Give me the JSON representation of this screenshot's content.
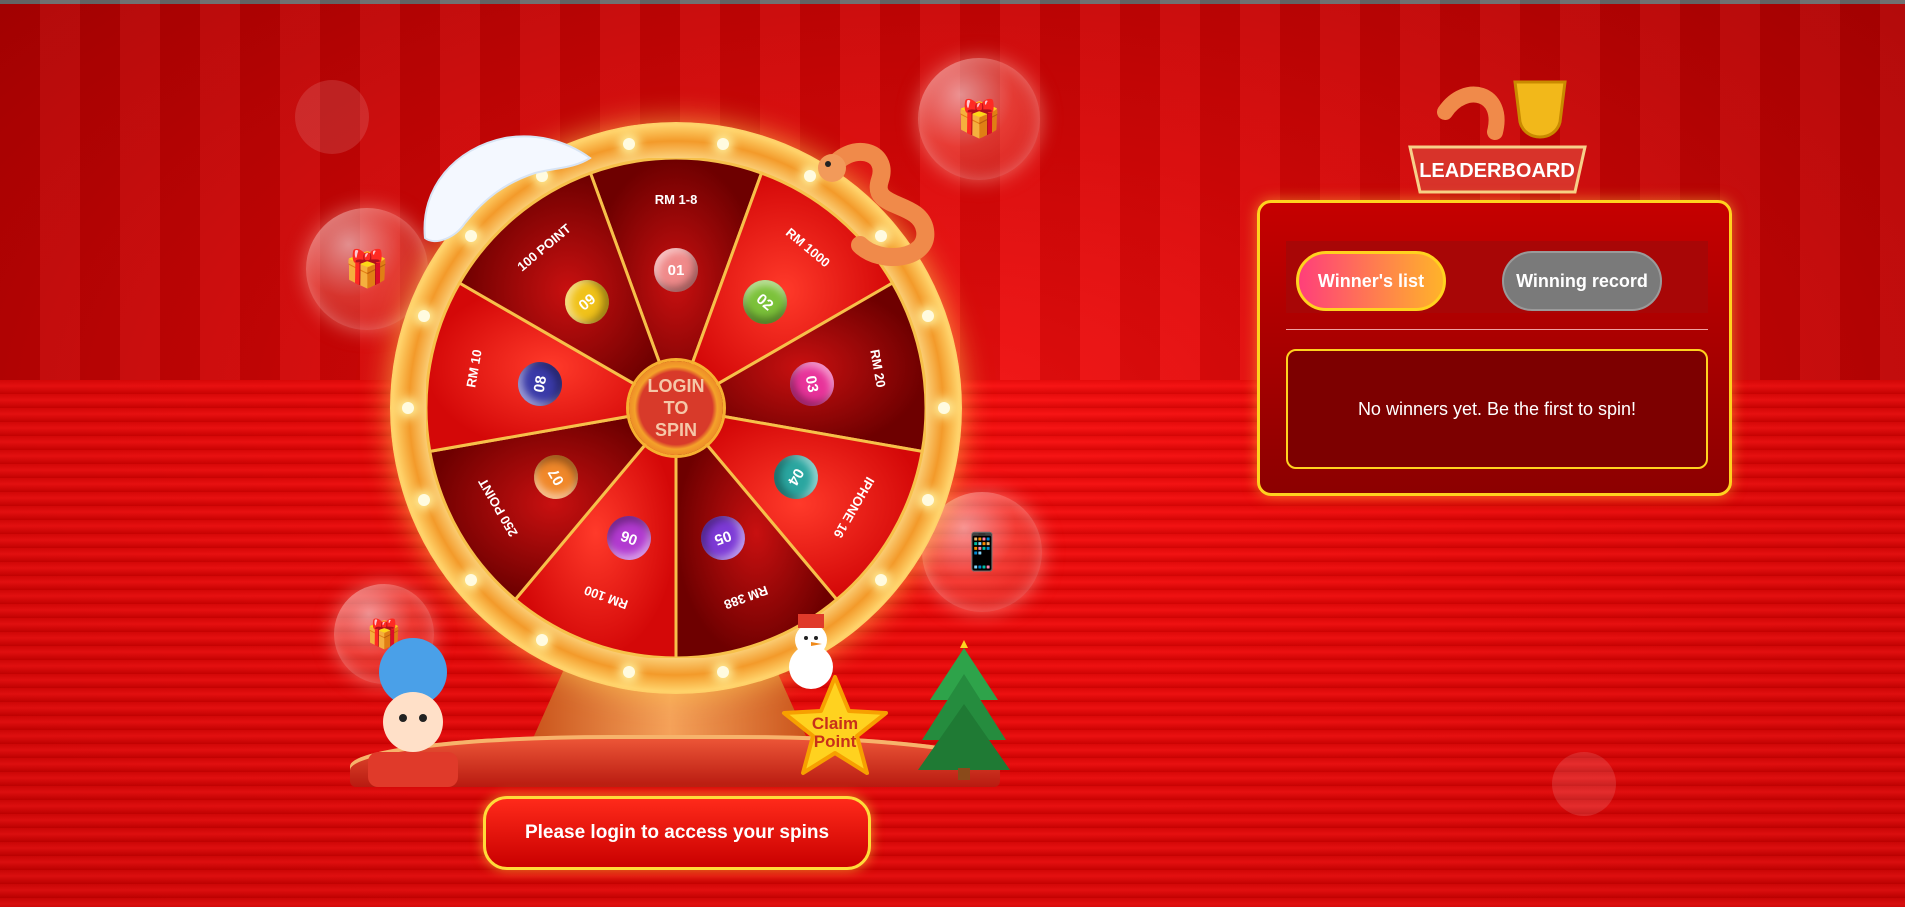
{
  "wheel": {
    "hub_label": "LOGIN\nTO\nSPIN",
    "segments": [
      {
        "label": "RM 1-8",
        "ball": "01",
        "color": "#f08a8a"
      },
      {
        "label": "RM 1000",
        "ball": "02",
        "color": "#7cc23a"
      },
      {
        "label": "RM 20",
        "ball": "03",
        "color": "#e8339a"
      },
      {
        "label": "IPHONE 16",
        "ball": "04",
        "color": "#2aa6a0"
      },
      {
        "label": "RM 388",
        "ball": "05",
        "color": "#7d3ad6"
      },
      {
        "label": "RM 100",
        "ball": "06",
        "color": "#b23ad0"
      },
      {
        "label": "250 POINT",
        "ball": "07",
        "color": "#f0882a"
      },
      {
        "label": "RM 10",
        "ball": "08",
        "color": "#3a3aa8"
      },
      {
        "label": "100 POINT",
        "ball": "09",
        "color": "#f0c21a"
      }
    ]
  },
  "claim_button": {
    "line1": "Claim",
    "line2": "Point"
  },
  "login_button": "Please login to access your spins",
  "leaderboard": {
    "logo_text": "LEADERBOARD",
    "tabs": [
      "Winner's list",
      "Winning record"
    ],
    "empty_message": "No winners yet. Be the first to spin!"
  }
}
